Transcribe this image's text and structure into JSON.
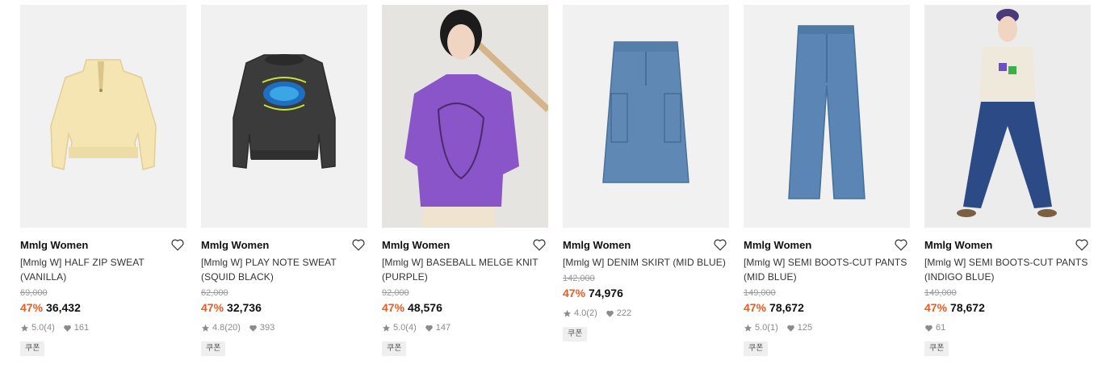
{
  "products": [
    {
      "brand": "Mmlg Women",
      "name_line1": "[Mmlg W] HALF ZIP SWEAT",
      "name_line2": "(VANILLA)",
      "original_price": "69,000",
      "discount": "47%",
      "price": "36,432",
      "rating": "5.0",
      "review_count": "(4)",
      "likes": "161",
      "coupon": "쿠폰",
      "image": "vanilla-half-zip-sweat-icon"
    },
    {
      "brand": "Mmlg Women",
      "name_line1": "[Mmlg W] PLAY NOTE SWEAT",
      "name_line2": "(SQUID BLACK)",
      "original_price": "62,000",
      "discount": "47%",
      "price": "32,736",
      "rating": "4.8",
      "review_count": "(20)",
      "likes": "393",
      "coupon": "쿠폰",
      "image": "black-play-note-sweat-icon"
    },
    {
      "brand": "Mmlg Women",
      "name_line1": "[Mmlg W] BASEBALL MELGE KNIT",
      "name_line2": "(PURPLE)",
      "original_price": "92,000",
      "discount": "47%",
      "price": "48,576",
      "rating": "5.0",
      "review_count": "(4)",
      "likes": "147",
      "coupon": "쿠폰",
      "image": "model-purple-knit-photo"
    },
    {
      "brand": "Mmlg Women",
      "name_line1": "[Mmlg W] DENIM SKIRT (MID BLUE)",
      "name_line2": "",
      "original_price": "142,000",
      "discount": "47%",
      "price": "74,976",
      "rating": "4.0",
      "review_count": "(2)",
      "likes": "222",
      "coupon": "쿠폰",
      "image": "denim-skirt-icon"
    },
    {
      "brand": "Mmlg Women",
      "name_line1": "[Mmlg W] SEMI BOOTS-CUT PANTS",
      "name_line2": "(MID BLUE)",
      "original_price": "149,000",
      "discount": "47%",
      "price": "78,672",
      "rating": "5.0",
      "review_count": "(1)",
      "likes": "125",
      "coupon": "쿠폰",
      "image": "mid-blue-pants-icon"
    },
    {
      "brand": "Mmlg Women",
      "name_line1": "[Mmlg W] SEMI BOOTS-CUT PANTS",
      "name_line2": "(INDIGO BLUE)",
      "original_price": "149,000",
      "discount": "47%",
      "price": "78,672",
      "rating": "",
      "review_count": "",
      "likes": "61",
      "coupon": "쿠폰",
      "image": "model-indigo-pants-photo"
    }
  ],
  "colors": {
    "discount": "#f05a1e",
    "meta": "#8a8a8a",
    "thumb_bg": "#f1f1f1"
  }
}
